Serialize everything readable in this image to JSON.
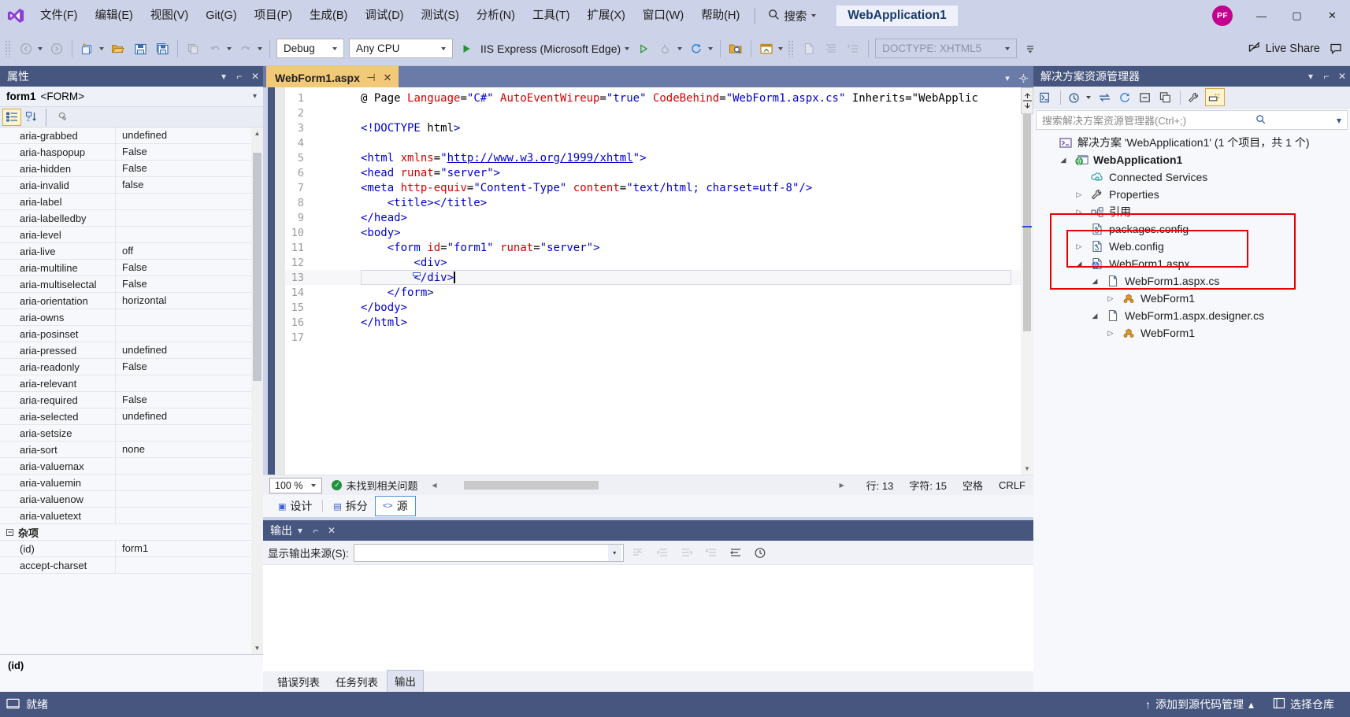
{
  "titlebar": {
    "menus": [
      "文件(F)",
      "编辑(E)",
      "视图(V)",
      "Git(G)",
      "项目(P)",
      "生成(B)",
      "调试(D)",
      "测试(S)",
      "分析(N)",
      "工具(T)",
      "扩展(X)",
      "窗口(W)",
      "帮助(H)"
    ],
    "search_label": "搜索",
    "project_title": "WebApplication1",
    "avatar_initials": "PF",
    "minimize": "—",
    "maximize": "▢",
    "close": "✕"
  },
  "toolbar": {
    "config": "Debug",
    "platform": "Any CPU",
    "run_target": "IIS Express (Microsoft Edge)",
    "doctype": "DOCTYPE: XHTML5",
    "live_share": "Live Share"
  },
  "properties": {
    "panel_title": "属性",
    "object_name": "form1",
    "object_type": "<FORM>",
    "rows": [
      {
        "name": "aria-grabbed",
        "value": "undefined"
      },
      {
        "name": "aria-haspopup",
        "value": "False"
      },
      {
        "name": "aria-hidden",
        "value": "False"
      },
      {
        "name": "aria-invalid",
        "value": "false"
      },
      {
        "name": "aria-label",
        "value": ""
      },
      {
        "name": "aria-labelledby",
        "value": ""
      },
      {
        "name": "aria-level",
        "value": ""
      },
      {
        "name": "aria-live",
        "value": "off"
      },
      {
        "name": "aria-multiline",
        "value": "False"
      },
      {
        "name": "aria-multiselectal",
        "value": "False"
      },
      {
        "name": "aria-orientation",
        "value": "horizontal"
      },
      {
        "name": "aria-owns",
        "value": ""
      },
      {
        "name": "aria-posinset",
        "value": ""
      },
      {
        "name": "aria-pressed",
        "value": "undefined"
      },
      {
        "name": "aria-readonly",
        "value": "False"
      },
      {
        "name": "aria-relevant",
        "value": ""
      },
      {
        "name": "aria-required",
        "value": "False"
      },
      {
        "name": "aria-selected",
        "value": "undefined"
      },
      {
        "name": "aria-setsize",
        "value": ""
      },
      {
        "name": "aria-sort",
        "value": "none"
      },
      {
        "name": "aria-valuemax",
        "value": ""
      },
      {
        "name": "aria-valuemin",
        "value": ""
      },
      {
        "name": "aria-valuenow",
        "value": ""
      },
      {
        "name": "aria-valuetext",
        "value": ""
      }
    ],
    "group_label": "杂项",
    "group_rows": [
      {
        "name": "(id)",
        "value": "form1"
      },
      {
        "name": "accept-charset",
        "value": ""
      }
    ],
    "footer_title": "(id)"
  },
  "editor": {
    "tab_name": "WebForm1.aspx",
    "tab_pin": "⊣",
    "tab_close": "✕",
    "lines": [
      {
        "n": "1",
        "text": "<%@ Page Language=\"C#\" AutoEventWireup=\"true\" CodeBehind=\"WebForm1.aspx.cs\" Inherits=\"WebApplic"
      },
      {
        "n": "2",
        "text": ""
      },
      {
        "n": "3",
        "text": "<!DOCTYPE html>"
      },
      {
        "n": "4",
        "text": ""
      },
      {
        "n": "5",
        "text": "<html xmlns=\"http://www.w3.org/1999/xhtml\">"
      },
      {
        "n": "6",
        "text": "<head runat=\"server\">"
      },
      {
        "n": "7",
        "text": "<meta http-equiv=\"Content-Type\" content=\"text/html; charset=utf-8\"/>"
      },
      {
        "n": "8",
        "text": "    <title></title>"
      },
      {
        "n": "9",
        "text": "</head>"
      },
      {
        "n": "10",
        "text": "<body>"
      },
      {
        "n": "11",
        "text": "    <form id=\"form1\" runat=\"server\">"
      },
      {
        "n": "12",
        "text": "        <div>"
      },
      {
        "n": "13",
        "text": "        </div>"
      },
      {
        "n": "14",
        "text": "    </form>"
      },
      {
        "n": "15",
        "text": "</body>"
      },
      {
        "n": "16",
        "text": "</html>"
      },
      {
        "n": "17",
        "text": ""
      }
    ],
    "status": {
      "zoom": "100 %",
      "issues": "未找到相关问题",
      "line_label": "行: 13",
      "char_label": "字符: 15",
      "spaces": "空格",
      "eol": "CRLF"
    },
    "view_tabs": [
      {
        "label": "设计",
        "selected": false
      },
      {
        "label": "拆分",
        "selected": false
      },
      {
        "label": "源",
        "selected": true
      }
    ]
  },
  "output": {
    "panel_title": "输出",
    "source_label": "显示输出来源(S):",
    "source_value": "",
    "tabs": [
      {
        "label": "错误列表",
        "selected": false
      },
      {
        "label": "任务列表",
        "selected": false
      },
      {
        "label": "输出",
        "selected": true
      }
    ]
  },
  "solution_explorer": {
    "panel_title": "解决方案资源管理器",
    "search_placeholder": "搜索解决方案资源管理器(Ctrl+;)",
    "tree": [
      {
        "depth": 0,
        "label": "解决方案 'WebApplication1' (1 个项目，共 1 个)",
        "icon": "solution-icon",
        "expander": "",
        "bold": false
      },
      {
        "depth": 1,
        "label": "WebApplication1",
        "icon": "project-web-icon",
        "expander": "▲",
        "bold": true
      },
      {
        "depth": 2,
        "label": "Connected Services",
        "icon": "connected-services-icon",
        "expander": "",
        "bold": false
      },
      {
        "depth": 2,
        "label": "Properties",
        "icon": "wrench-icon",
        "expander": "▷",
        "bold": false
      },
      {
        "depth": 2,
        "label": "引用",
        "icon": "references-icon",
        "expander": "▷",
        "bold": false
      },
      {
        "depth": 2,
        "label": "packages.config",
        "icon": "config-file-icon",
        "expander": "",
        "bold": false
      },
      {
        "depth": 2,
        "label": "Web.config",
        "icon": "config-file-icon",
        "expander": "▷",
        "bold": false
      },
      {
        "depth": 2,
        "label": "WebForm1.aspx",
        "icon": "aspx-file-icon",
        "expander": "▲",
        "bold": false
      },
      {
        "depth": 3,
        "label": "WebForm1.aspx.cs",
        "icon": "cs-file-icon",
        "expander": "▲",
        "bold": false
      },
      {
        "depth": 4,
        "label": "WebForm1",
        "icon": "class-icon",
        "expander": "▷",
        "bold": false
      },
      {
        "depth": 3,
        "label": "WebForm1.aspx.designer.cs",
        "icon": "cs-file-icon",
        "expander": "▲",
        "bold": false
      },
      {
        "depth": 4,
        "label": "WebForm1",
        "icon": "class-icon",
        "expander": "▷",
        "bold": false
      }
    ]
  },
  "statusbar": {
    "ready": "就绪",
    "source_control": "添加到源代码管理",
    "repo": "选择仓库",
    "up_arrow": "↑"
  }
}
